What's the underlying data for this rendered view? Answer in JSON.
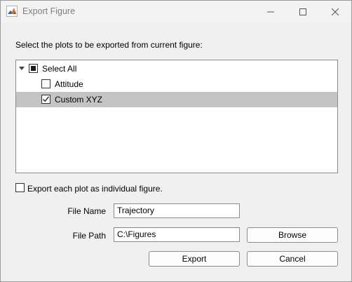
{
  "window": {
    "title": "Export Figure",
    "app_icon": "matlab-icon",
    "controls": {
      "minimize": "minimize-icon",
      "maximize": "maximize-icon",
      "close": "close-icon"
    }
  },
  "instructions": "Select the plots to be exported from current figure:",
  "tree": {
    "root": {
      "label": "Select All",
      "state": "mixed",
      "expanded": true
    },
    "items": [
      {
        "label": "Attitude",
        "checked": false,
        "selected": false
      },
      {
        "label": "Custom XYZ",
        "checked": true,
        "selected": true
      }
    ]
  },
  "export_each": {
    "label": "Export each plot as individual figure.",
    "checked": false
  },
  "file_name": {
    "label": "File Name",
    "value": "Trajectory"
  },
  "file_path": {
    "label": "File Path",
    "value": "C:\\Figures"
  },
  "buttons": {
    "browse": "Browse",
    "export": "Export",
    "cancel": "Cancel"
  },
  "colors": {
    "selection": "#c4c4c4",
    "window_bg": "#f0f0f0"
  }
}
